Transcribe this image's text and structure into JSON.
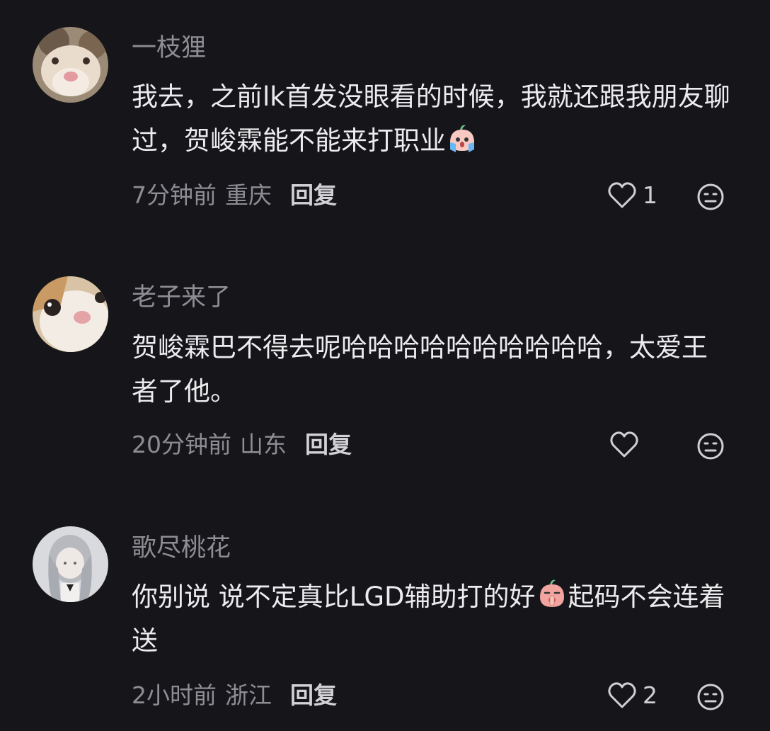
{
  "comments": [
    {
      "username": "一枝狸",
      "text_part1": "我去，之前lk首发没眼看的时候，我就还跟我朋友聊过，贺峻霖能不能来打职业",
      "text_part2": "",
      "emoji": "crying-peach-emoji",
      "time": "7分钟前",
      "location": "重庆",
      "reply_label": "回复",
      "like_count": "1",
      "avatar": "cat-avatar"
    },
    {
      "username": "老子来了",
      "text_part1": "贺峻霖巴不得去呢哈哈哈哈哈哈哈哈哈哈，太爱王者了他。",
      "text_part2": "",
      "emoji": "",
      "time": "20分钟前",
      "location": "山东",
      "reply_label": "回复",
      "like_count": "",
      "avatar": "cat-avatar"
    },
    {
      "username": "歌尽桃花",
      "text_part1": "你别说 说不定真比LGD辅助打的好",
      "text_part2": "起码不会连着送",
      "emoji": "shush-peach-emoji",
      "time": "2小时前",
      "location": "浙江",
      "reply_label": "回复",
      "like_count": "2",
      "avatar": "anime-girl-avatar"
    }
  ],
  "colors": {
    "background": "#16161a",
    "username": "#8d8d93",
    "content": "#ececee",
    "meta": "#8d8d93",
    "reply": "#d2d2d6"
  }
}
